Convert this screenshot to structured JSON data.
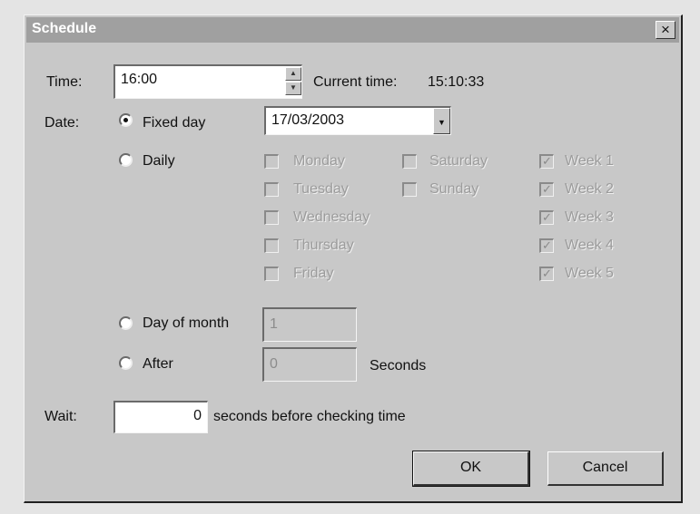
{
  "window": {
    "title": "Schedule",
    "close_glyph": "×"
  },
  "time": {
    "label": "Time:",
    "value": "16:00",
    "current_label": "Current time:",
    "current_value": "15:10:33"
  },
  "date": {
    "label": "Date:",
    "fixed_day": {
      "label": "Fixed day",
      "value": "17/03/2003",
      "selected": true
    },
    "daily": {
      "label": "Daily",
      "days": [
        {
          "label": "Monday",
          "checked": false
        },
        {
          "label": "Tuesday",
          "checked": false
        },
        {
          "label": "Wednesday",
          "checked": false
        },
        {
          "label": "Thursday",
          "checked": false
        },
        {
          "label": "Friday",
          "checked": false
        },
        {
          "label": "Saturday",
          "checked": false
        },
        {
          "label": "Sunday",
          "checked": false
        }
      ],
      "weeks": [
        {
          "label": "Week 1",
          "checked": true
        },
        {
          "label": "Week 2",
          "checked": true
        },
        {
          "label": "Week 3",
          "checked": true
        },
        {
          "label": "Week 4",
          "checked": true
        },
        {
          "label": "Week 5",
          "checked": true
        }
      ]
    },
    "day_of_month": {
      "label": "Day of month",
      "value": "1"
    },
    "after": {
      "label": "After",
      "value": "0",
      "unit": "Seconds"
    }
  },
  "wait": {
    "label": "Wait:",
    "value": "0",
    "suffix": "seconds before checking time"
  },
  "buttons": {
    "ok": "OK",
    "cancel": "Cancel"
  },
  "icons": {
    "check_glyph": "✓",
    "spin_up": "▲",
    "spin_down": "▼",
    "dropdown": "▼"
  },
  "colors": {
    "title_bar": "#a0a0a0",
    "dialog_bg": "#c8c8c8",
    "disabled_text": "#9c9c9c"
  }
}
